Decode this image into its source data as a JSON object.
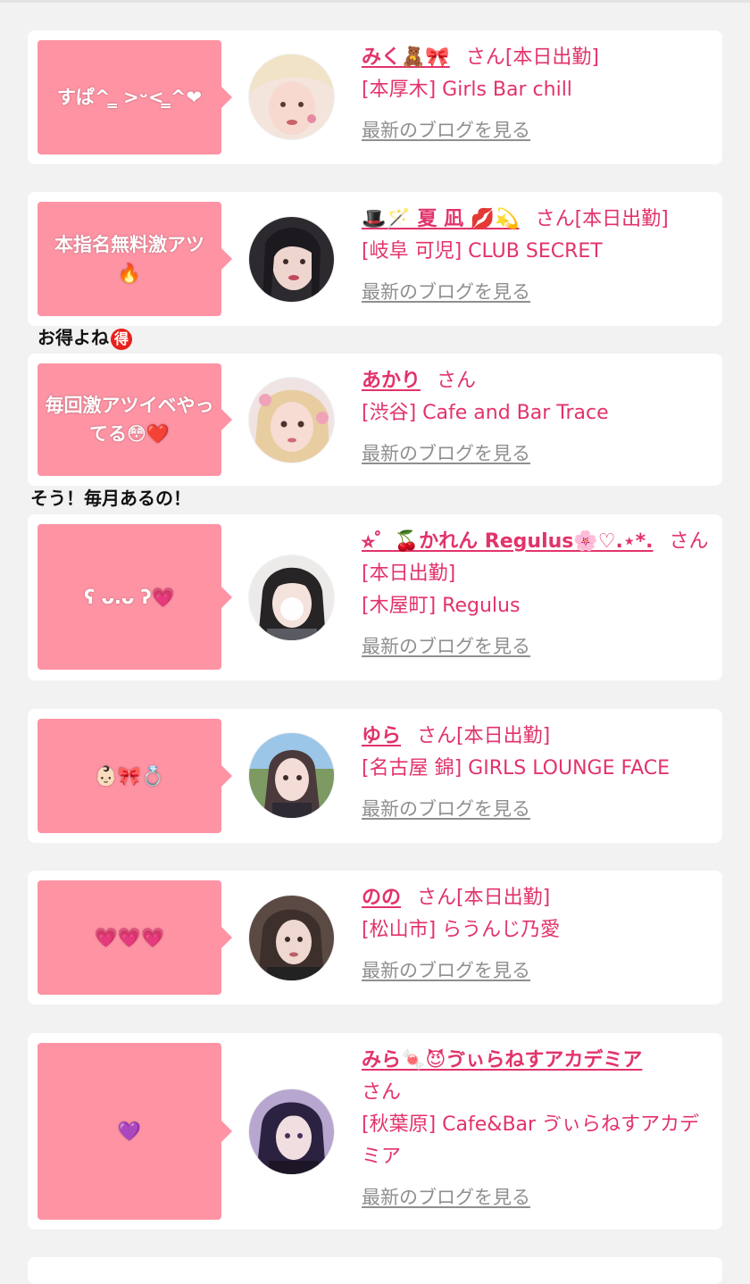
{
  "blog_link_label": "最新のブログを見る",
  "colors": {
    "accent": "#e2336a",
    "bubble": "#fe93a4",
    "link_gray": "#8f8f8f"
  },
  "cards": [
    {
      "message": "すぱ^ ̳ >ᵕ< ̳^❤",
      "name": "みく🧸🎀",
      "suffix": "さん",
      "status": "[本日出勤]",
      "shop": "[本厚木] Girls Bar chill"
    },
    {
      "message": "本指名無料激アツ🔥",
      "name": "🎩🪄 夏 凪 💋💫",
      "suffix": "さん",
      "status": "[本日出勤]",
      "shop": "[岐阜 可児] CLUB SECRET"
    },
    {
      "message": "毎回激アツイベやってる😳❤️",
      "name": "あかり",
      "suffix": "さん",
      "status": "",
      "shop": "[渋谷] Cafe and Bar Trace"
    },
    {
      "message": "ʕ ᴗ.ᴗ ʔ💗",
      "name": "⭐︎゜🍒かれん Regulus🌸♡.⋆*.",
      "suffix": "さん",
      "status": "[本日出勤]",
      "shop": "[木屋町] Regulus"
    },
    {
      "message": "👶🏻🎀💍",
      "name": "ゆら",
      "suffix": "さん",
      "status": "[本日出勤]",
      "shop": "[名古屋 錦] GIRLS LOUNGE FACE"
    },
    {
      "message": "💗💗💗",
      "name": "のの",
      "suffix": "さん",
      "status": "[本日出勤]",
      "shop": "[松山市] らうんじ乃愛"
    },
    {
      "message": "💜",
      "name": "みら🍬😈ゔぃらねすアカデミア",
      "suffix": "さん",
      "status": "",
      "shop": "[秋葉原] Cafe&Bar ゔぃらねすアカデミア"
    }
  ],
  "comments": {
    "first_text": "お得よね",
    "first_badge": "得",
    "second_text": "そう！毎月あるの！"
  }
}
